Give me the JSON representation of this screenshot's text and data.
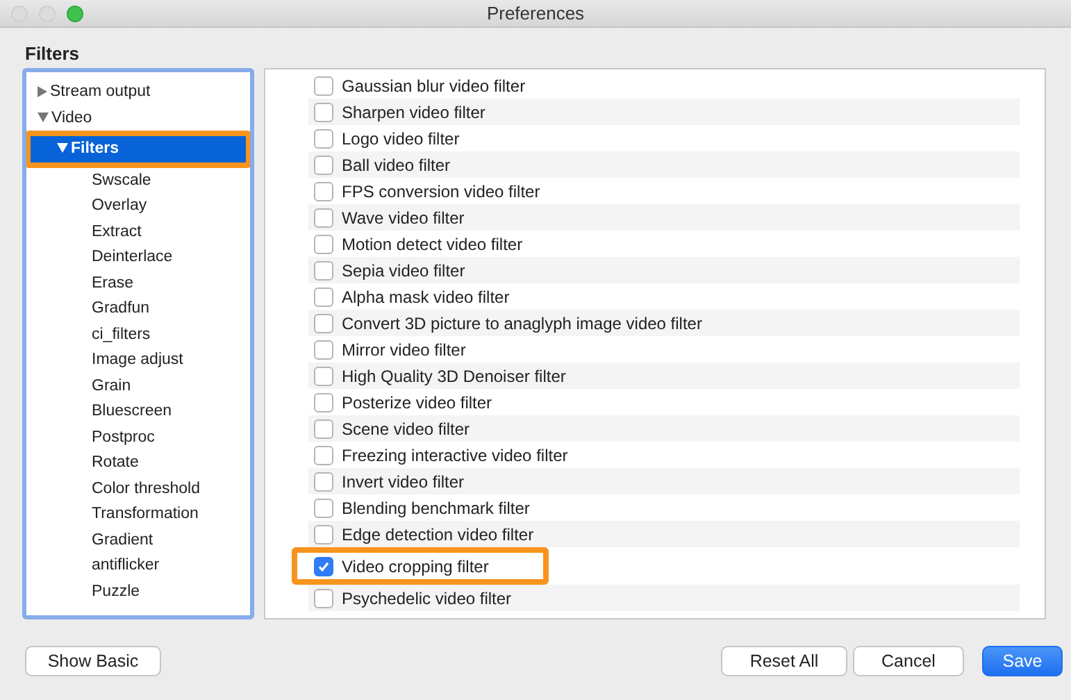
{
  "window": {
    "title": "Preferences"
  },
  "section_title": "Filters",
  "tree": [
    {
      "label": "Stream output",
      "expanded": false,
      "selected": false,
      "highlighted": false
    },
    {
      "label": "Video",
      "expanded": true,
      "selected": false,
      "highlighted": false,
      "children": [
        {
          "label": "Filters",
          "expanded": true,
          "selected": true,
          "highlighted": true,
          "children": [
            {
              "label": "Swscale",
              "selected": false,
              "highlighted": false
            },
            {
              "label": "Overlay",
              "selected": false,
              "highlighted": false
            },
            {
              "label": "Extract",
              "selected": false,
              "highlighted": false
            },
            {
              "label": "Deinterlace",
              "selected": false,
              "highlighted": false
            },
            {
              "label": "Erase",
              "selected": false,
              "highlighted": false
            },
            {
              "label": "Gradfun",
              "selected": false,
              "highlighted": false
            },
            {
              "label": "ci_filters",
              "selected": false,
              "highlighted": false
            },
            {
              "label": "Image adjust",
              "selected": false,
              "highlighted": false
            },
            {
              "label": "Grain",
              "selected": false,
              "highlighted": false
            },
            {
              "label": "Bluescreen",
              "selected": false,
              "highlighted": false
            },
            {
              "label": "Postproc",
              "selected": false,
              "highlighted": false
            },
            {
              "label": "Rotate",
              "selected": false,
              "highlighted": false
            },
            {
              "label": "Color threshold",
              "selected": false,
              "highlighted": false
            },
            {
              "label": "Transformation",
              "selected": false,
              "highlighted": false
            },
            {
              "label": "Gradient",
              "selected": false,
              "highlighted": false
            },
            {
              "label": "antiflicker",
              "selected": false,
              "highlighted": false
            },
            {
              "label": "Puzzle",
              "selected": false,
              "highlighted": false
            }
          ]
        }
      ]
    }
  ],
  "filters": [
    {
      "label": "Gaussian blur video filter",
      "checked": false,
      "highlighted": false
    },
    {
      "label": "Sharpen video filter",
      "checked": false,
      "highlighted": false
    },
    {
      "label": "Logo video filter",
      "checked": false,
      "highlighted": false
    },
    {
      "label": "Ball video filter",
      "checked": false,
      "highlighted": false
    },
    {
      "label": "FPS conversion video filter",
      "checked": false,
      "highlighted": false
    },
    {
      "label": "Wave video filter",
      "checked": false,
      "highlighted": false
    },
    {
      "label": "Motion detect video filter",
      "checked": false,
      "highlighted": false
    },
    {
      "label": "Sepia video filter",
      "checked": false,
      "highlighted": false
    },
    {
      "label": "Alpha mask video filter",
      "checked": false,
      "highlighted": false
    },
    {
      "label": "Convert 3D picture to anaglyph image video filter",
      "checked": false,
      "highlighted": false
    },
    {
      "label": "Mirror video filter",
      "checked": false,
      "highlighted": false
    },
    {
      "label": "High Quality 3D Denoiser filter",
      "checked": false,
      "highlighted": false
    },
    {
      "label": "Posterize video filter",
      "checked": false,
      "highlighted": false
    },
    {
      "label": "Scene video filter",
      "checked": false,
      "highlighted": false
    },
    {
      "label": "Freezing interactive video filter",
      "checked": false,
      "highlighted": false
    },
    {
      "label": "Invert video filter",
      "checked": false,
      "highlighted": false
    },
    {
      "label": "Blending benchmark filter",
      "checked": false,
      "highlighted": false
    },
    {
      "label": "Edge detection video filter",
      "checked": false,
      "highlighted": false
    },
    {
      "label": "Video cropping filter",
      "checked": true,
      "highlighted": true
    },
    {
      "label": "Psychedelic video filter",
      "checked": false,
      "highlighted": false
    }
  ],
  "buttons": [
    {
      "label": "Show Basic",
      "kind": "default"
    },
    {
      "label": "Reset All",
      "kind": "default"
    },
    {
      "label": "Cancel",
      "kind": "default"
    },
    {
      "label": "Save",
      "kind": "primary"
    }
  ]
}
